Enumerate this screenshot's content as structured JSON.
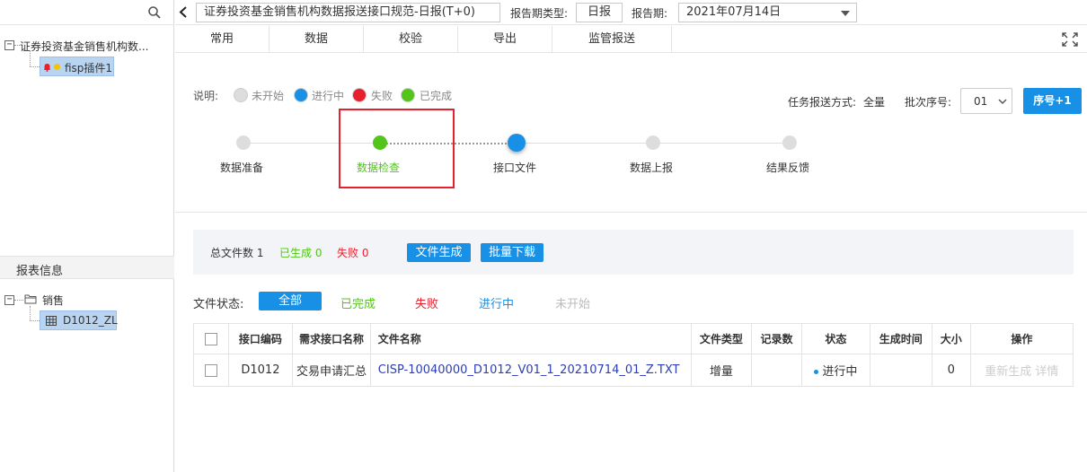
{
  "left_panel": {
    "tree": {
      "root_label": "证券投资基金销售机构数...",
      "child_label": "fisp插件1"
    },
    "report_info": {
      "header": "报表信息",
      "folder_label": "销售",
      "item_label": "D1012_ZL"
    }
  },
  "toolbar": {
    "title": "证券投资基金销售机构数据报送接口规范-日报(T+0)",
    "period_type_label": "报告期类型:",
    "period_type_value": "日报",
    "period_label": "报告期:",
    "period_value": "2021年07月14日"
  },
  "menu": [
    "常用",
    "数据",
    "校验",
    "导出",
    "监管报送"
  ],
  "legend": {
    "prefix": "说明:",
    "items": [
      {
        "label": "未开始",
        "color": "#dddddd"
      },
      {
        "label": "进行中",
        "color": "#1890e6"
      },
      {
        "label": "失败",
        "color": "#e8202e"
      },
      {
        "label": "已完成",
        "color": "#52c41a"
      }
    ]
  },
  "task": {
    "mode_label": "任务报送方式:",
    "mode_value": "全量",
    "batch_label": "批次序号:",
    "batch_value": "01",
    "increment_button": "序号+1"
  },
  "steps": [
    {
      "label": "数据准备",
      "status": "未开始"
    },
    {
      "label": "数据检查",
      "status": "已完成"
    },
    {
      "label": "接口文件",
      "status": "进行中"
    },
    {
      "label": "数据上报",
      "status": "未开始"
    },
    {
      "label": "结果反馈",
      "status": "未开始"
    }
  ],
  "summary": {
    "total_label": "总文件数",
    "total_value": "1",
    "done_label": "已生成",
    "done_value": "0",
    "fail_label": "失败",
    "fail_value": "0",
    "generate_button": "文件生成",
    "download_button": "批量下载"
  },
  "filters": {
    "label": "文件状态:",
    "all": "全部",
    "done": "已完成",
    "fail": "失败",
    "running": "进行中",
    "not_started": "未开始"
  },
  "table": {
    "headers": [
      "接口编码",
      "需求接口名称",
      "文件名称",
      "文件类型",
      "记录数",
      "状态",
      "生成时间",
      "大小",
      "操作"
    ],
    "rows": [
      {
        "code": "D1012",
        "name": "交易申请汇总",
        "file": "CISP-10040000_D1012_V01_1_20210714_01_Z.TXT",
        "type": "增量",
        "records": "",
        "status": "进行中",
        "time": "",
        "size": "0",
        "action_regen": "重新生成",
        "action_detail": "详情"
      }
    ]
  },
  "colors": {
    "accent": "#1890e6",
    "success": "#52c41a",
    "danger": "#e8202e",
    "highlight_box": "#e8202e",
    "link": "#2b3db8"
  }
}
